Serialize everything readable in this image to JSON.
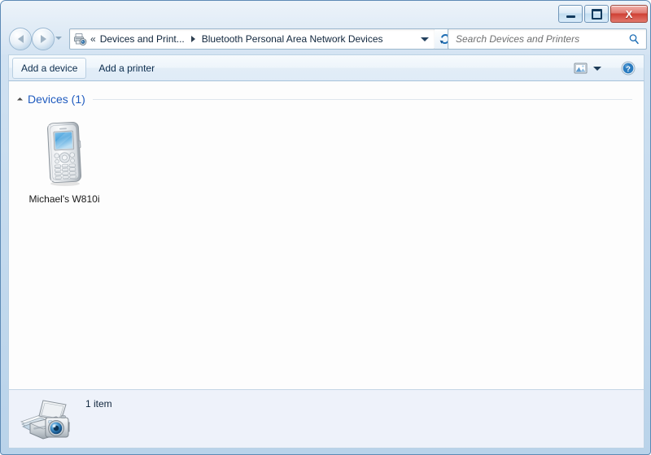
{
  "window": {
    "controls": {
      "minimize_label": "Minimize",
      "maximize_label": "Maximize",
      "close_label": "X"
    }
  },
  "navigation": {
    "back_label": "Back",
    "forward_label": "Forward",
    "recent_pages_label": "Recent pages"
  },
  "address": {
    "icon_name": "devices-and-printers-icon",
    "overflow_chevron": "«",
    "crumbs": [
      {
        "label": "Devices and Print..."
      },
      {
        "label": "Bluetooth Personal Area Network Devices"
      }
    ],
    "dropdown_label": "Previous locations",
    "refresh_label": "Refresh"
  },
  "search": {
    "placeholder": "Search Devices and Printers",
    "value": ""
  },
  "toolbar": {
    "items": [
      {
        "label": "Add a device",
        "active": true
      },
      {
        "label": "Add a printer",
        "active": false
      }
    ],
    "view_label": "Change your view",
    "help_label": "Help"
  },
  "content": {
    "group": {
      "label": "Devices (1)"
    },
    "devices": [
      {
        "label": "Michael's W810i",
        "icon_name": "mobile-phone-icon"
      }
    ]
  },
  "statusbar": {
    "icon_name": "devices-and-printers-large-icon",
    "text": "1 item"
  },
  "colors": {
    "frame": "#b9d3ea",
    "accent_blue": "#1f5bbf",
    "close_red": "#cf4034",
    "content_bg": "#fdfdfd",
    "status_bg": "#eef2fa"
  }
}
